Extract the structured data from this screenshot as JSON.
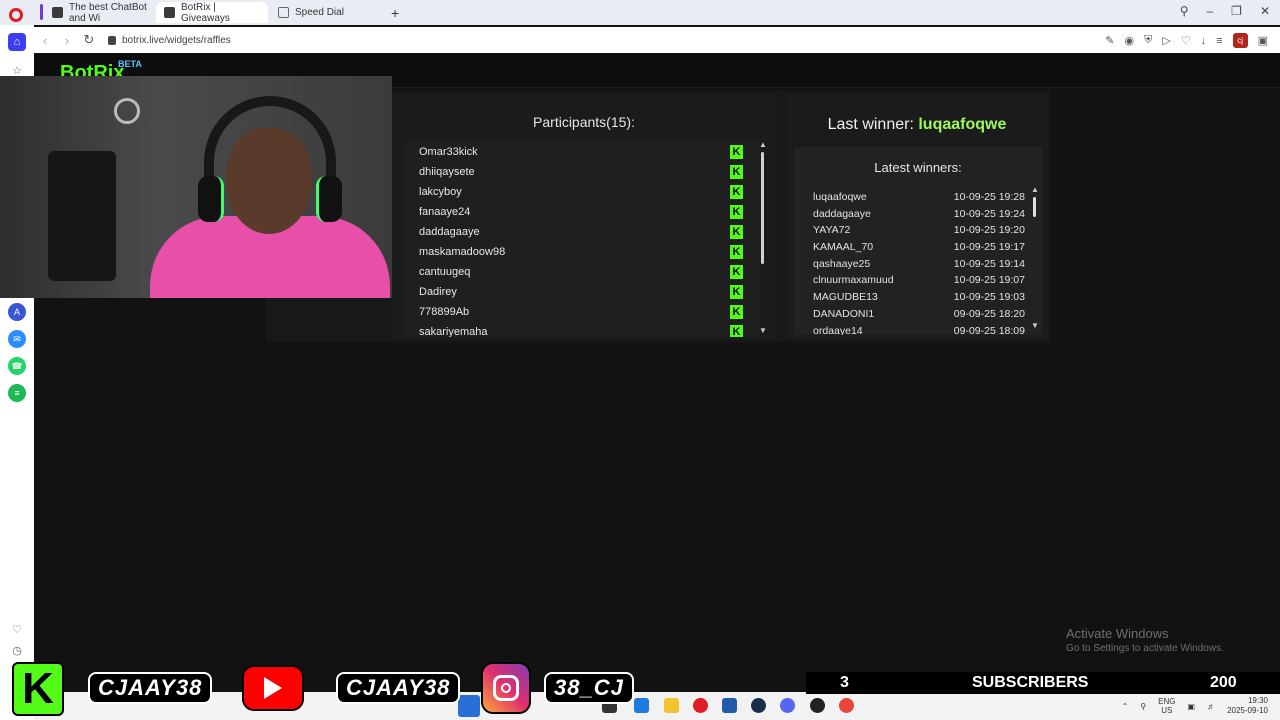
{
  "browser": {
    "tabs": [
      {
        "label": "The best ChatBot and Wi"
      },
      {
        "label": "BotRix | Giveaways"
      },
      {
        "label": "Speed Dial"
      }
    ],
    "url": "botrix.live/widgets/raffles",
    "profile_initials": "cj"
  },
  "site": {
    "brand": "BotRix",
    "brand_badge": "BETA"
  },
  "participants": {
    "title": "Participants(15):",
    "platform_badge": "K",
    "items": [
      "Omar33kick",
      "dhiiqaysete",
      "lakcyboy",
      "fanaaye24",
      "daddagaaye",
      "maskamadoow98",
      "cantuugeq",
      "Dadirey",
      "778899Ab",
      "sakariyemaha"
    ]
  },
  "winners": {
    "last_winner_label": "Last winner:",
    "last_winner_name": "luqaafoqwe",
    "latest_title": "Latest winners:",
    "items": [
      {
        "name": "luqaafoqwe",
        "time": "10-09-25 19:28"
      },
      {
        "name": "daddagaaye",
        "time": "10-09-25 19:24"
      },
      {
        "name": "YAYA72",
        "time": "10-09-25 19:20"
      },
      {
        "name": "KAMAAL_70",
        "time": "10-09-25 19:17"
      },
      {
        "name": "qashaaye25",
        "time": "10-09-25 19:14"
      },
      {
        "name": "clnuurmaxamuud",
        "time": "10-09-25 19:07"
      },
      {
        "name": "MAGUDBE13",
        "time": "10-09-25 19:03"
      },
      {
        "name": "DANADONI1",
        "time": "09-09-25 18:20"
      },
      {
        "name": "ordaaye14",
        "time": "09-09-25 18:09"
      }
    ]
  },
  "windows_notice": {
    "title": "Activate Windows",
    "subtitle": "Go to Settings to activate Windows."
  },
  "overlay": {
    "kick_handle": "CJAAY38",
    "youtube_handle": "CJAAY38",
    "instagram_handle": "38_CJ",
    "subscriber_count": "3",
    "subscriber_label": "SUBSCRIBERS",
    "subscriber_goal": "200"
  },
  "taskbar": {
    "lang_top": "ENG",
    "lang_bottom": "US",
    "time": "19:30",
    "date": "2025-09-10"
  },
  "colors": {
    "kick_green": "#53fc18",
    "winner_green": "#a0f75c",
    "panel_bg": "#1b1b1b"
  }
}
